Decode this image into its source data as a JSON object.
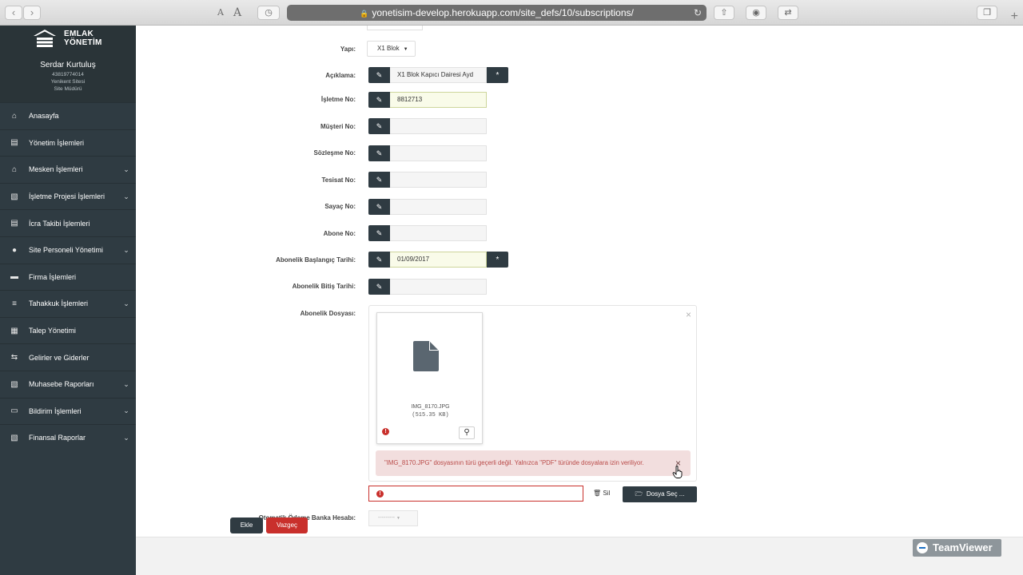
{
  "browser": {
    "url": "yonetisim-develop.herokuapp.com/site_defs/10/subscriptions/",
    "font_small": "A",
    "font_large": "A"
  },
  "sidebar": {
    "logo_line1": "EMLAK",
    "logo_line2": "YÖNETİM",
    "user_name": "Serdar Kurtuluş",
    "user_phone": "43819774014",
    "user_site": "Yenikent Sitesi",
    "user_role": "Site Müdürü",
    "items": [
      {
        "label": "Anasayfa",
        "icon": "home-icon",
        "caret": false
      },
      {
        "label": "Yönetim İşlemleri",
        "icon": "document-icon",
        "caret": false
      },
      {
        "label": "Mesken İşlemleri",
        "icon": "building-icon",
        "caret": true
      },
      {
        "label": "İşletme Projesi İşlemleri",
        "icon": "files-icon",
        "caret": true
      },
      {
        "label": "İcra Takibi İşlemleri",
        "icon": "document-icon",
        "caret": false
      },
      {
        "label": "Site Personeli Yönetimi",
        "icon": "user-icon",
        "caret": true
      },
      {
        "label": "Firma İşlemleri",
        "icon": "briefcase-icon",
        "caret": false
      },
      {
        "label": "Tahakkuk İşlemleri",
        "icon": "list-icon",
        "caret": true
      },
      {
        "label": "Talep Yönetimi",
        "icon": "table-icon",
        "caret": false
      },
      {
        "label": "Gelirler ve Giderler",
        "icon": "exchange-icon",
        "caret": false
      },
      {
        "label": "Muhasebe Raporları",
        "icon": "files-icon",
        "caret": true
      },
      {
        "label": "Bildirim İşlemleri",
        "icon": "inbox-icon",
        "caret": true
      },
      {
        "label": "Finansal Raporlar",
        "icon": "files-icon",
        "caret": true
      }
    ]
  },
  "form": {
    "yapi_label": "Yapı:",
    "yapi_value": "X1 Blok",
    "aciklama_label": "Açıklama:",
    "aciklama_value": "X1 Blok Kapıcı Dairesi Ayd",
    "isletme_label": "İşletme No:",
    "isletme_value": "8812713",
    "musteri_label": "Müşteri No:",
    "musteri_value": "",
    "sozlesme_label": "Sözleşme No:",
    "sozlesme_value": "",
    "tesisat_label": "Tesisat No:",
    "tesisat_value": "",
    "sayac_label": "Sayaç No:",
    "sayac_value": "",
    "abone_label": "Abone No:",
    "abone_value": "",
    "baslangic_label": "Abonelik Başlangıç Tarihi:",
    "baslangic_value": "01/09/2017",
    "bitis_label": "Abonelik Bitiş Tarihi:",
    "bitis_value": "",
    "dosya_label": "Abonelik Dosyası:",
    "banka_label": "Otomatik Ödeme Banka Hesabı:",
    "banka_value": "---------",
    "required_mark": "*",
    "panel_close": "×"
  },
  "upload": {
    "file_name": "IMG_8170.JPG",
    "file_size": "(515.35 KB)",
    "error_message": "\"IMG_8170.JPG\" dosyasının türü geçerli değil. Yalnızca \"PDF\" türünde dosyalara izin veriliyor.",
    "delete_label": "Sil",
    "browse_label": "Dosya Seç ...",
    "warn_mark": "!"
  },
  "actions": {
    "add_label": "Ekle",
    "cancel_label": "Vazgeç"
  },
  "watermark": {
    "text": "TeamViewer"
  },
  "colors": {
    "sidebar": "#2f3b42",
    "danger": "#c9302c",
    "alert_bg": "#f2dede"
  }
}
